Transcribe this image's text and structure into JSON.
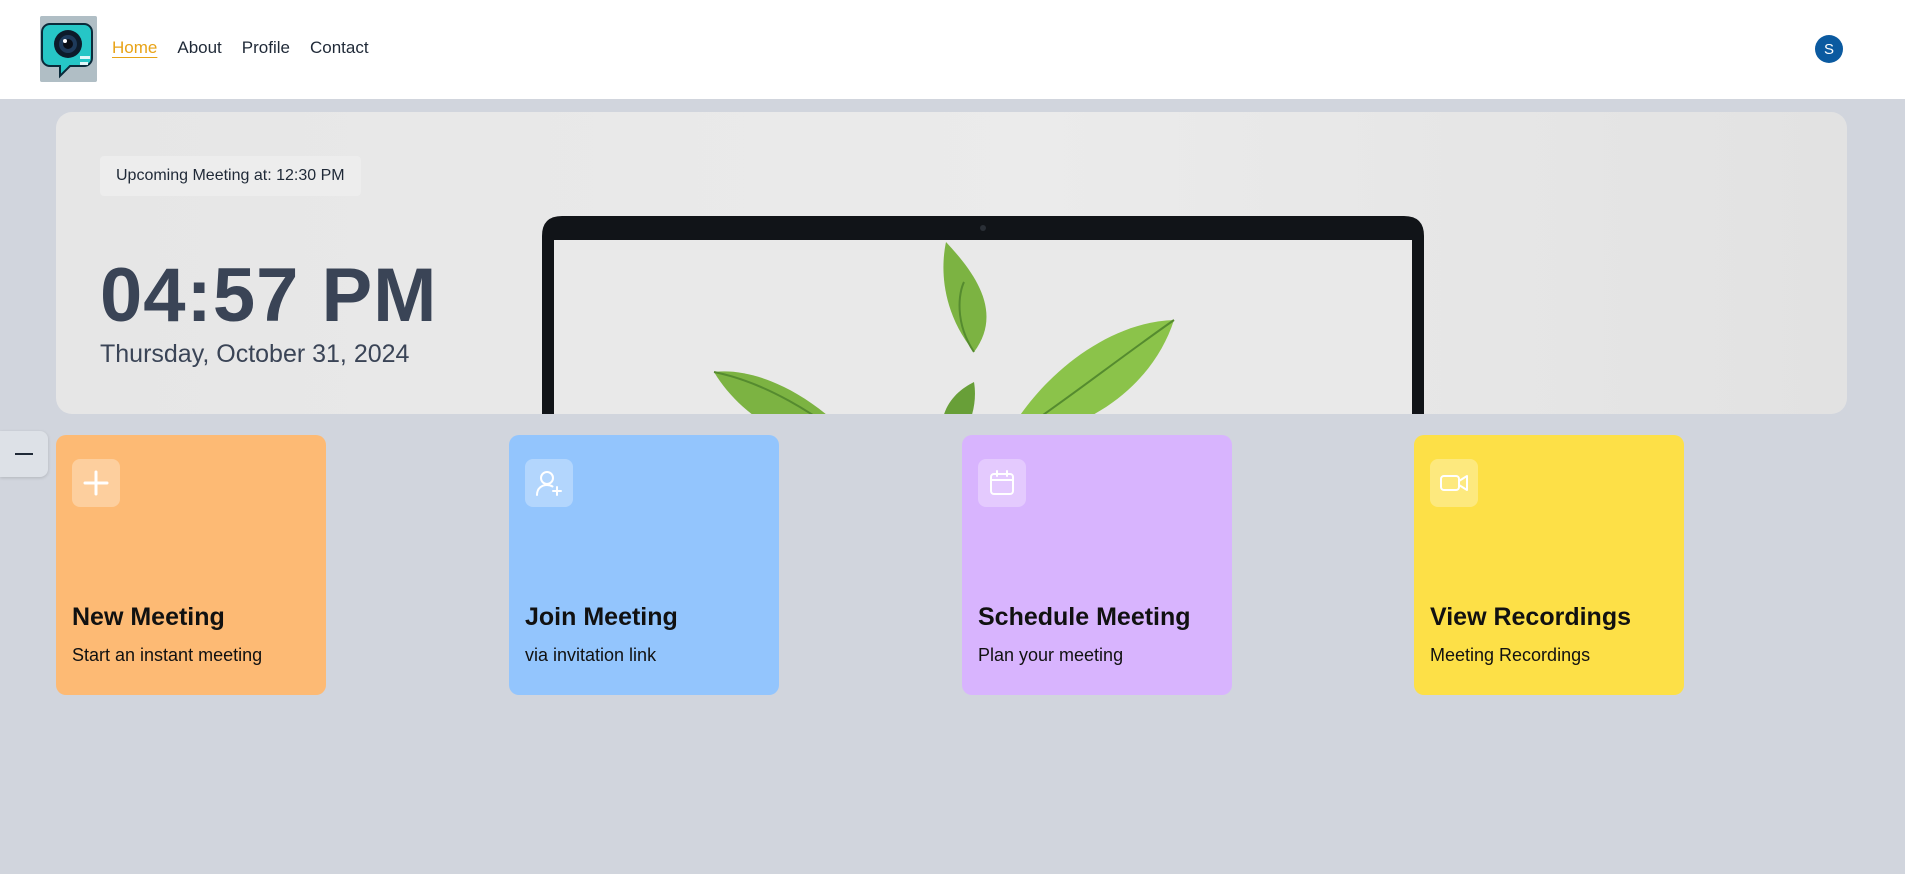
{
  "nav": {
    "items": [
      {
        "label": "Home",
        "active": true
      },
      {
        "label": "About",
        "active": false
      },
      {
        "label": "Profile",
        "active": false
      },
      {
        "label": "Contact",
        "active": false
      }
    ],
    "avatar_initial": "S"
  },
  "hero": {
    "upcoming_label": "Upcoming Meeting at: 12:30 PM",
    "time": "04:57 PM",
    "date": "Thursday, October 31, 2024"
  },
  "cards": [
    {
      "title": "New Meeting",
      "subtitle": "Start an instant meeting",
      "icon": "plus-icon",
      "color": "#fdba74"
    },
    {
      "title": "Join Meeting",
      "subtitle": "via invitation link",
      "icon": "user-plus-icon",
      "color": "#93c5fd"
    },
    {
      "title": "Schedule Meeting",
      "subtitle": "Plan your meeting",
      "icon": "calendar-icon",
      "color": "#d8b4fe"
    },
    {
      "title": "View Recordings",
      "subtitle": "Meeting Recordings",
      "icon": "video-icon",
      "color": "#fde047"
    }
  ],
  "colors": {
    "accent": "#e8a317",
    "avatar_bg": "#0b5aa0",
    "page_bg": "#d1d5dd",
    "clock_text": "#3a4456"
  }
}
